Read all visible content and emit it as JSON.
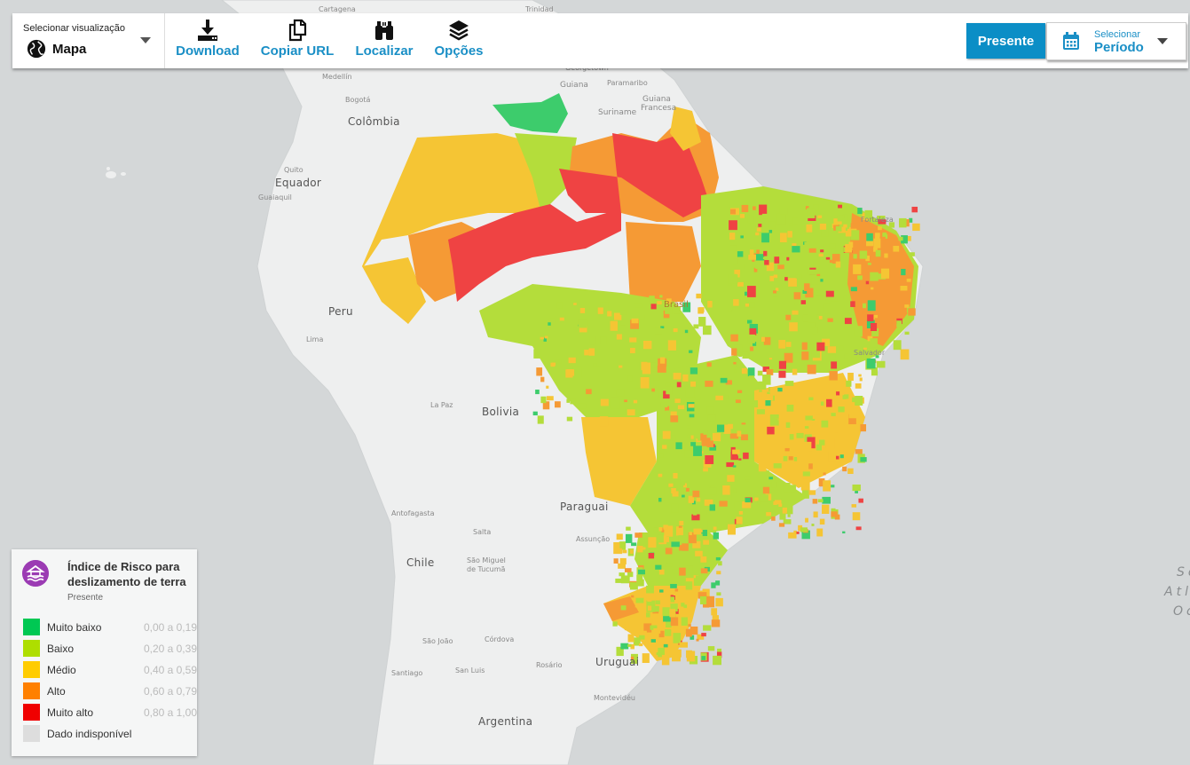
{
  "toolbar": {
    "view_select": {
      "label": "Selecionar visualização",
      "value": "Mapa",
      "icon": "globe-icon"
    },
    "buttons": [
      {
        "label": "Download",
        "icon": "download-icon"
      },
      {
        "label": "Copiar URL",
        "icon": "copy-icon"
      },
      {
        "label": "Localizar",
        "icon": "binoculars-icon"
      },
      {
        "label": "Opções",
        "icon": "layers-icon"
      }
    ],
    "present_button": "Presente",
    "period_select": {
      "small": "Selecionar",
      "value": "Período",
      "icon": "calendar-icon"
    }
  },
  "map": {
    "country_labels": [
      "Colômbia",
      "Equador",
      "Peru",
      "Bolivia",
      "Paraguai",
      "Chile",
      "Uruguai",
      "Argentina",
      "Guiana",
      "Suriname",
      "Guiana Francesa",
      "Brasil"
    ],
    "city_labels": [
      "Cartagena",
      "Trinidad",
      "Medellín",
      "Bogotá",
      "Quito",
      "Guaiaquil",
      "Lima",
      "La Paz",
      "Antofagasta",
      "Salta",
      "Assunção",
      "São Miguel de Tucumã",
      "São João",
      "Córdova",
      "Santiago",
      "San Luis",
      "Rosário",
      "Montevidéu",
      "Paramaribo",
      "Georgetown",
      "Fortaleza",
      "Salvador"
    ],
    "ocean_label": [
      "Se",
      "Atl",
      "Oc"
    ]
  },
  "legend": {
    "title": "Índice de Risco para deslizamento de terra",
    "subtitle": "Presente",
    "icon": "flood-house-icon",
    "items": [
      {
        "name": "Muito baixo",
        "range": "0,00 a 0,19",
        "color": "#00c853"
      },
      {
        "name": "Baixo",
        "range": "0,20 a 0,39",
        "color": "#aede00"
      },
      {
        "name": "Médio",
        "range": "0,40 a 0,59",
        "color": "#ffcc00"
      },
      {
        "name": "Alto",
        "range": "0,60 a 0,79",
        "color": "#ff8000"
      },
      {
        "name": "Muito alto",
        "range": "0,80 a 1,00",
        "color": "#f00000"
      },
      {
        "name": "Dado indisponível",
        "range": "",
        "color": "#dddddd"
      }
    ]
  },
  "colors": {
    "accent": "#0b8ec6",
    "link": "#1a8fc6",
    "legend_icon": "#9b3bb3"
  }
}
